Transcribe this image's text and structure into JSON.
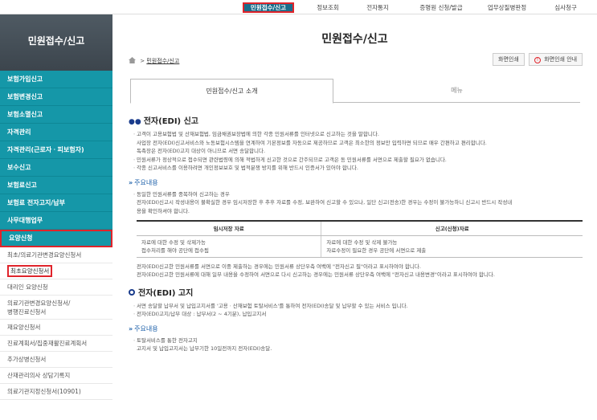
{
  "topnav": {
    "items": [
      {
        "label": "민원접수/신고"
      },
      {
        "label": "정보조회"
      },
      {
        "label": "전자통지"
      },
      {
        "label": "증명원 신청/발급"
      },
      {
        "label": "업무상질병판정"
      },
      {
        "label": "심사청구"
      }
    ]
  },
  "sidebar": {
    "title": "민원접수/신고",
    "main_items": [
      {
        "label": "보험가입신고"
      },
      {
        "label": "보험변경신고"
      },
      {
        "label": "보험소멸신고"
      },
      {
        "label": "자격관리"
      },
      {
        "label": "자격관리(근로자ㆍ피보험자)"
      },
      {
        "label": "보수신고"
      },
      {
        "label": "보험료신고"
      },
      {
        "label": "보험료 전자고지/납부"
      },
      {
        "label": "사무대행업무"
      },
      {
        "label": "요양신청"
      }
    ],
    "sub_items": [
      {
        "label": "최초/의료기관변경요양신청서"
      },
      {
        "label": "최초요양신청서"
      },
      {
        "label": "대리인 요양신청"
      },
      {
        "label": "의료기관변경요양신청서/",
        "label2": "병행진료신청서"
      },
      {
        "label": "재요양신청서"
      },
      {
        "label": "진료계획서/집중재활진료계획서"
      },
      {
        "label": "추가상병신청서"
      },
      {
        "label": "산재관리의사 상담기록지"
      },
      {
        "label": "의료기관지정신청서(10901)"
      }
    ]
  },
  "main": {
    "title": "민원접수/신고",
    "breadcrumb": "민원접수/신고",
    "print_button": "화면인쇄",
    "print_guide_button": "화면인쇄 안내",
    "print_guide_icon": "!",
    "tabs": [
      {
        "label": "민원접수/신고 소개"
      },
      {
        "label": "메뉴"
      }
    ],
    "sections": {
      "edi_report": {
        "heading": "전자(EDI) 신고",
        "lines": [
          "ㆍ고객이 고용보험법 및 산재보험법, 임금채권보장법에 의한 각종 민원서류를 인터넷으로 신고하는 것을 말합니다.",
          "사업장 전자(EDI)신고서비스와 노동보험시스템을 연계하여 기본정보를 자동으로 제공하므로 고객은 최소한의 정보만 입력하면 되므로 매우 간편하고 편리합니다.",
          "독촉장은 전자(EDI)고지 대상이 아니므로 서면 송달합니다.",
          "ㆍ민원서류가 정상적으로 접수되면 관련법령에 의해 적법하게 신고한 것으로 간주되므로 고객은 동 민원서류를 서면으로 제출할 필요가 없습니다.",
          "ㆍ각종 신고서비스를 이용하려면 개인정보보호 및 법적분쟁 방지를 위해 반드시 인증서가 있어야 합니다."
        ],
        "sub_heading": "주요내용",
        "sub_lines": [
          "ㆍ동일한 민원서류를 중복하여 신고하는 경우",
          "전자(EDI)신고시 작성내용이 불확실한 경우 임시저장한 후 추후 자료를 수정, 보완하여 신고할 수 있으나, 일단 신고(전송)한 경우는 수정이 불가능하니 신고시 반드시 작성내",
          "용을 확인하셔야 합니다."
        ],
        "table": {
          "headers": [
            "임시저장 자료",
            "신고(신청)자료"
          ],
          "rows": [
            [
              "자료에 대한 수정 및 삭제가능",
              "자료에 대한 수정 및 삭제 불가능"
            ],
            [
              "접수처리를 해야 공단에 접수됨",
              "자료수정이 필요한 경우 공단에 서면으로 제출"
            ]
          ]
        },
        "after_lines": [
          "전자(EDI)신고한 민원서류를 서면으로 이중 제출하는 경우에는 민원서류 상단우측 여백에 \"전자신고 필\"이라고 표시하여야 합니다.",
          "전자(EDI)신고한 민원서류에 대해 일부 내용을 수정하여 서면으로 다시 신고하는 경우에는 민원서류 상단우측 여백에 \"전자신고 내용변경\"이라고 표시하여야 합니다."
        ]
      },
      "edi_notice": {
        "heading": "전자(EDI) 고지",
        "lines": [
          "ㆍ서면 송달할 납부서 및 납입고지서를 '고용ㆍ산재보험 토탈서비스'를 통하여 전자(EDI)송달 및 납부할 수 있는 서비스 입니다.",
          "ㆍ전자(EDI)고지/납부 대상 : 납부서(2 ~ 4기분), 납입고지서"
        ],
        "sub_heading": "주요내용",
        "sub_lines": [
          "ㆍ토탈서비스를 통한 전자고지",
          "고지서 및 납입고지서는 납부기한 10일전까지 전자(EDI)송달."
        ]
      }
    }
  }
}
